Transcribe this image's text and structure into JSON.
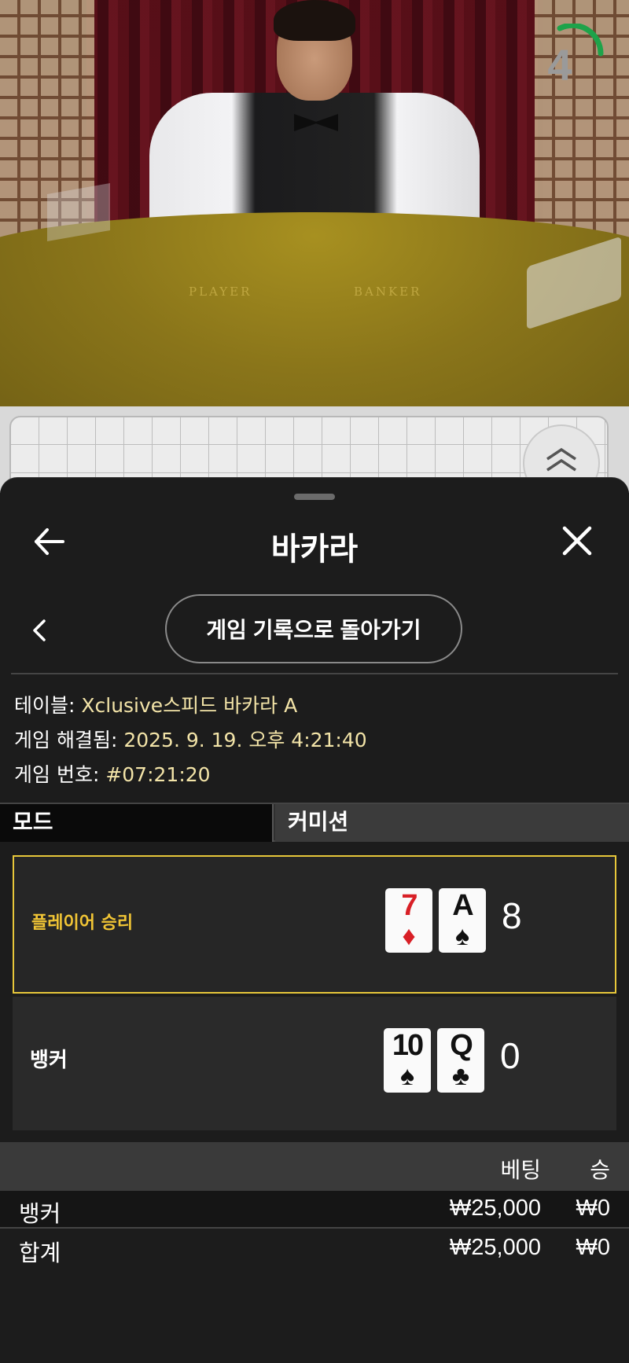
{
  "video": {
    "table_labels": [
      "PLAYER",
      "BANKER"
    ],
    "timer": {
      "value": "4",
      "accent_color": "#1ea34a"
    }
  },
  "sheet": {
    "title": "바카라",
    "back_to_history": "게임 기록으로 돌아가기",
    "info": {
      "table_label": "테이블: ",
      "table_value": "Xclusive스피드 바카라 A",
      "resolved_label": "게임 해결됨: ",
      "resolved_value": "2025. 9. 19. 오후 4:21:40",
      "game_no_label": "게임 번호: ",
      "game_no_value": "#07:21:20"
    },
    "mode": {
      "tab_mode": "모드",
      "tab_commission": "커미션"
    },
    "results": [
      {
        "label": "플레이어 승리",
        "winner": true,
        "cards": [
          {
            "rank": "7",
            "suit": "♦",
            "color": "red"
          },
          {
            "rank": "A",
            "suit": "♠",
            "color": "black"
          }
        ],
        "score": "8"
      },
      {
        "label": "뱅커",
        "winner": false,
        "cards": [
          {
            "rank": "10",
            "suit": "♠",
            "color": "black"
          },
          {
            "rank": "Q",
            "suit": "♣",
            "color": "black"
          }
        ],
        "score": "0"
      }
    ],
    "bets": {
      "col_bet": "베팅",
      "col_win": "승",
      "rows": [
        {
          "name": "뱅커",
          "bet": "₩25,000",
          "win": "₩0"
        },
        {
          "name": "합계",
          "bet": "₩25,000",
          "win": "₩0"
        }
      ]
    }
  },
  "icons": {
    "back": "arrow-left-icon",
    "close": "close-icon",
    "chevron": "chevron-left-icon",
    "expand": "double-chevron-up-icon"
  },
  "colors": {
    "accent_yellow": "#e7c73a",
    "info_value": "#f3e4a8",
    "card_red": "#d81f26"
  }
}
